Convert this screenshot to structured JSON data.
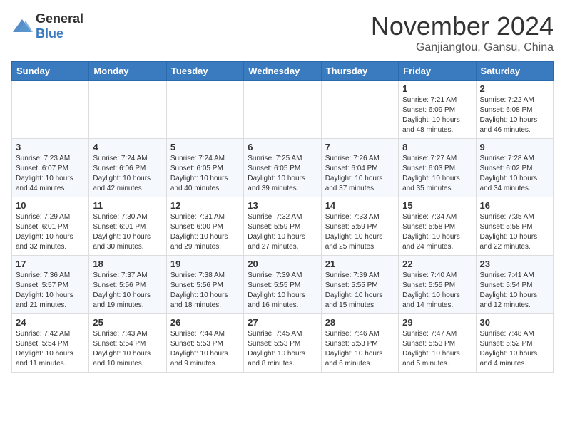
{
  "header": {
    "logo_general": "General",
    "logo_blue": "Blue",
    "month": "November 2024",
    "location": "Ganjiangtou, Gansu, China"
  },
  "weekdays": [
    "Sunday",
    "Monday",
    "Tuesday",
    "Wednesday",
    "Thursday",
    "Friday",
    "Saturday"
  ],
  "weeks": [
    [
      {
        "day": "",
        "info": ""
      },
      {
        "day": "",
        "info": ""
      },
      {
        "day": "",
        "info": ""
      },
      {
        "day": "",
        "info": ""
      },
      {
        "day": "",
        "info": ""
      },
      {
        "day": "1",
        "info": "Sunrise: 7:21 AM\nSunset: 6:09 PM\nDaylight: 10 hours and 48 minutes."
      },
      {
        "day": "2",
        "info": "Sunrise: 7:22 AM\nSunset: 6:08 PM\nDaylight: 10 hours and 46 minutes."
      }
    ],
    [
      {
        "day": "3",
        "info": "Sunrise: 7:23 AM\nSunset: 6:07 PM\nDaylight: 10 hours and 44 minutes."
      },
      {
        "day": "4",
        "info": "Sunrise: 7:24 AM\nSunset: 6:06 PM\nDaylight: 10 hours and 42 minutes."
      },
      {
        "day": "5",
        "info": "Sunrise: 7:24 AM\nSunset: 6:05 PM\nDaylight: 10 hours and 40 minutes."
      },
      {
        "day": "6",
        "info": "Sunrise: 7:25 AM\nSunset: 6:05 PM\nDaylight: 10 hours and 39 minutes."
      },
      {
        "day": "7",
        "info": "Sunrise: 7:26 AM\nSunset: 6:04 PM\nDaylight: 10 hours and 37 minutes."
      },
      {
        "day": "8",
        "info": "Sunrise: 7:27 AM\nSunset: 6:03 PM\nDaylight: 10 hours and 35 minutes."
      },
      {
        "day": "9",
        "info": "Sunrise: 7:28 AM\nSunset: 6:02 PM\nDaylight: 10 hours and 34 minutes."
      }
    ],
    [
      {
        "day": "10",
        "info": "Sunrise: 7:29 AM\nSunset: 6:01 PM\nDaylight: 10 hours and 32 minutes."
      },
      {
        "day": "11",
        "info": "Sunrise: 7:30 AM\nSunset: 6:01 PM\nDaylight: 10 hours and 30 minutes."
      },
      {
        "day": "12",
        "info": "Sunrise: 7:31 AM\nSunset: 6:00 PM\nDaylight: 10 hours and 29 minutes."
      },
      {
        "day": "13",
        "info": "Sunrise: 7:32 AM\nSunset: 5:59 PM\nDaylight: 10 hours and 27 minutes."
      },
      {
        "day": "14",
        "info": "Sunrise: 7:33 AM\nSunset: 5:59 PM\nDaylight: 10 hours and 25 minutes."
      },
      {
        "day": "15",
        "info": "Sunrise: 7:34 AM\nSunset: 5:58 PM\nDaylight: 10 hours and 24 minutes."
      },
      {
        "day": "16",
        "info": "Sunrise: 7:35 AM\nSunset: 5:58 PM\nDaylight: 10 hours and 22 minutes."
      }
    ],
    [
      {
        "day": "17",
        "info": "Sunrise: 7:36 AM\nSunset: 5:57 PM\nDaylight: 10 hours and 21 minutes."
      },
      {
        "day": "18",
        "info": "Sunrise: 7:37 AM\nSunset: 5:56 PM\nDaylight: 10 hours and 19 minutes."
      },
      {
        "day": "19",
        "info": "Sunrise: 7:38 AM\nSunset: 5:56 PM\nDaylight: 10 hours and 18 minutes."
      },
      {
        "day": "20",
        "info": "Sunrise: 7:39 AM\nSunset: 5:55 PM\nDaylight: 10 hours and 16 minutes."
      },
      {
        "day": "21",
        "info": "Sunrise: 7:39 AM\nSunset: 5:55 PM\nDaylight: 10 hours and 15 minutes."
      },
      {
        "day": "22",
        "info": "Sunrise: 7:40 AM\nSunset: 5:55 PM\nDaylight: 10 hours and 14 minutes."
      },
      {
        "day": "23",
        "info": "Sunrise: 7:41 AM\nSunset: 5:54 PM\nDaylight: 10 hours and 12 minutes."
      }
    ],
    [
      {
        "day": "24",
        "info": "Sunrise: 7:42 AM\nSunset: 5:54 PM\nDaylight: 10 hours and 11 minutes."
      },
      {
        "day": "25",
        "info": "Sunrise: 7:43 AM\nSunset: 5:54 PM\nDaylight: 10 hours and 10 minutes."
      },
      {
        "day": "26",
        "info": "Sunrise: 7:44 AM\nSunset: 5:53 PM\nDaylight: 10 hours and 9 minutes."
      },
      {
        "day": "27",
        "info": "Sunrise: 7:45 AM\nSunset: 5:53 PM\nDaylight: 10 hours and 8 minutes."
      },
      {
        "day": "28",
        "info": "Sunrise: 7:46 AM\nSunset: 5:53 PM\nDaylight: 10 hours and 6 minutes."
      },
      {
        "day": "29",
        "info": "Sunrise: 7:47 AM\nSunset: 5:53 PM\nDaylight: 10 hours and 5 minutes."
      },
      {
        "day": "30",
        "info": "Sunrise: 7:48 AM\nSunset: 5:52 PM\nDaylight: 10 hours and 4 minutes."
      }
    ]
  ]
}
